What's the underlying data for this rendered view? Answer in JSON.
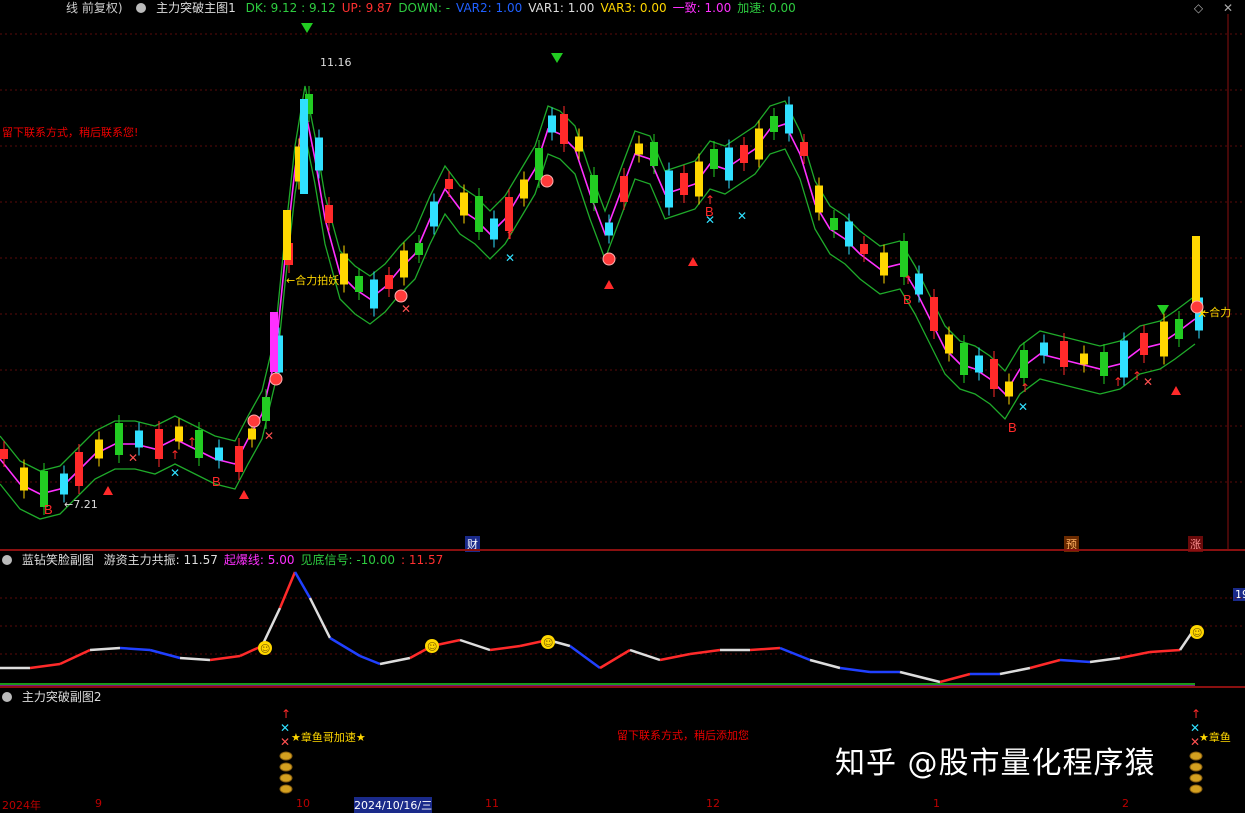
{
  "main_header": {
    "title_prefix": "线 前复权)",
    "indicator_name": "主力突破主图1",
    "items": [
      {
        "text": "DK: 9.12 : 9.12",
        "color": "#2ecc40"
      },
      {
        "text": "UP: 9.87",
        "color": "#ff3030"
      },
      {
        "text": "DOWN: -",
        "color": "#2ecc40"
      },
      {
        "text": "VAR2: 1.00",
        "color": "#2060ff"
      },
      {
        "text": "VAR1: 1.00",
        "color": "#dddddd"
      },
      {
        "text": "VAR3: 0.00",
        "color": "#ffd700"
      },
      {
        "text": "一致: 1.00",
        "color": "#ff30ff"
      },
      {
        "text": "加速: 0.00",
        "color": "#2ecc40"
      }
    ]
  },
  "main_chart": {
    "high_label": "11.16",
    "low_label": "7.21",
    "note_left": "留下联系方式，稍后联系您!",
    "label_hl": "←合力拍妖",
    "label_right": "←合力",
    "marker_cai": "财",
    "marker_yu": "预",
    "marker_zhang": "涨"
  },
  "sub1_header": {
    "name": "蓝钻笑脸副图",
    "items": [
      {
        "text": "游资主力共振: 11.57",
        "color": "#dddddd"
      },
      {
        "text": "起爆线: 5.00",
        "color": "#ff30ff"
      },
      {
        "text": "见底信号: -10.00",
        "color": "#2ecc40"
      },
      {
        "text": ": 11.57",
        "color": "#ff3030"
      }
    ],
    "right_value": "19"
  },
  "sub2_header": {
    "name": "主力突破副图2",
    "label_accel": "★章鱼哥加速★",
    "label_right": "★章鱼",
    "note_center": "留下联系方式，稍后添加您"
  },
  "xaxis": {
    "labels": [
      "2024年",
      "9",
      "10",
      "2024/10/16/三",
      "11",
      "12",
      "1",
      "2"
    ]
  },
  "watermark": "知乎 @股市量化程序猿"
}
